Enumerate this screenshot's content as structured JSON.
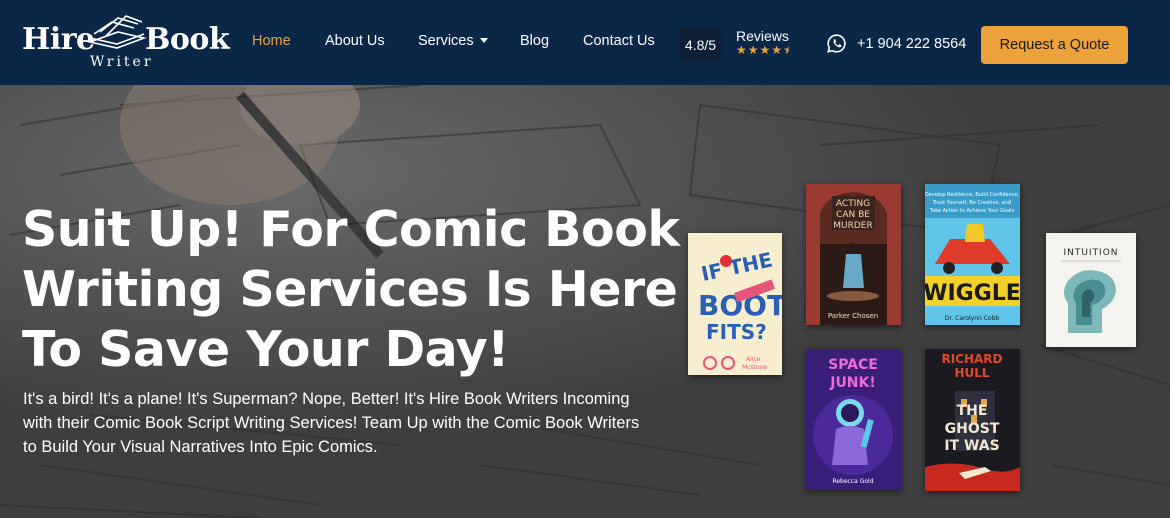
{
  "brand": {
    "word1": "Hire",
    "word2": "Book",
    "word3": "Writer"
  },
  "nav": {
    "items": [
      {
        "label": "Home"
      },
      {
        "label": "About Us"
      },
      {
        "label": "Services"
      },
      {
        "label": "Blog"
      },
      {
        "label": "Contact Us"
      }
    ],
    "rating": "4.8/5",
    "reviews_label": "Reviews",
    "stars": 4.5,
    "phone": "+1 904 222 8564",
    "cta": "Request a Quote"
  },
  "hero": {
    "title": "Suit Up! For Comic Book Writing Services Is Here To Save Your Day!",
    "text": "It's a bird! It's a plane! It's Superman? Nope, Better! It's Hire Book Writers Incoming with their Comic Book Script Writing Services! Team Up with the Comic Book Writers to Build Your Visual Narratives Into Epic Comics."
  },
  "books": [
    {
      "title": "If The Boot Fits?",
      "author": "Alice Mcstone"
    },
    {
      "title": "Acting Can Be Murder",
      "author": "Parker Chosen"
    },
    {
      "title": "Wiggle",
      "author": "Dr. Carolynn Cobb"
    },
    {
      "title": "Intuition",
      "author": ""
    },
    {
      "title": "Space Junk!",
      "author": "Rebecca Gold"
    },
    {
      "title": "Richard Hull",
      "subtitle": "The Ghost It Was"
    }
  ],
  "colors": {
    "nav_bg": "#0b2747",
    "accent": "#eba23a"
  }
}
